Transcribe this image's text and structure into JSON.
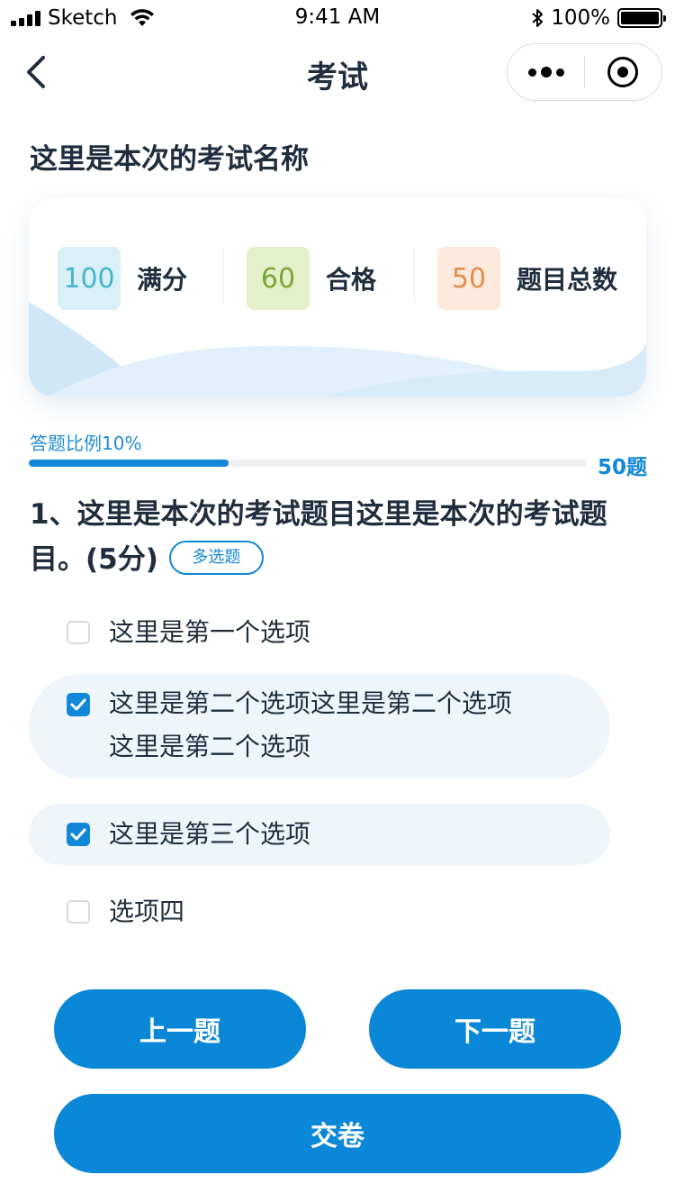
{
  "status_bar": {
    "carrier": "Sketch",
    "time": "9:41 AM",
    "battery": "100%"
  },
  "nav": {
    "title": "考试",
    "back_icon": "chevron-left-icon",
    "more_icon": "more-dots-icon",
    "close_icon": "target-circle-icon"
  },
  "exam": {
    "name": "这里是本次的考试名称"
  },
  "stats": [
    {
      "value": "100",
      "label": "满分",
      "color": "#46b4cc",
      "bg": "#d9f1f6"
    },
    {
      "value": "60",
      "label": "合格",
      "color": "#7da53a",
      "bg": "#e4f0c9"
    },
    {
      "value": "50",
      "label": "题目总数",
      "color": "#e58b4a",
      "bg": "#fdeadd"
    }
  ],
  "progress": {
    "label": "答题比例10%",
    "fraction": 0.1,
    "total": "50题"
  },
  "question": {
    "text": "1、这里是本次的考试题目这里是本次的考试题目。(5分)",
    "type": "多选题"
  },
  "options": [
    {
      "lines": [
        "这里是第一个选项"
      ],
      "checked": false
    },
    {
      "lines": [
        "这里是第二个选项这里是第二个选项",
        "这里是第二个选项"
      ],
      "checked": true
    },
    {
      "lines": [
        "这里是第三个选项"
      ],
      "checked": true
    },
    {
      "lines": [
        "选项四"
      ],
      "checked": false
    }
  ],
  "buttons": {
    "prev": "上一题",
    "next": "下一题",
    "submit": "交卷"
  },
  "colors": {
    "accent": "#0a87d6",
    "progress": "#1187d8",
    "selected_bg": "#eef6fb"
  }
}
